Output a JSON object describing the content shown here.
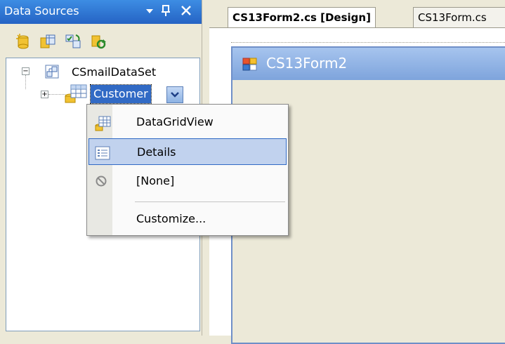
{
  "data_sources_panel": {
    "title": "Data Sources",
    "title_buttons": [
      "dropdown-arrow-icon",
      "pin-icon",
      "close-icon"
    ],
    "toolbar_icons": [
      "add-new-data-source-icon",
      "edit-dataset-with-designer-icon",
      "configure-dataset-icon",
      "refresh-icon"
    ],
    "tree": {
      "dataset": {
        "label": "CSmailDataSet",
        "expanded": true
      },
      "table": {
        "label": "Customer",
        "selected": true,
        "expanded": false
      }
    }
  },
  "context_menu": {
    "items": [
      {
        "label": "DataGridView",
        "icon": "datagridview-icon"
      },
      {
        "label": "Details",
        "icon": "details-icon",
        "highlighted": true
      },
      {
        "label": "[None]",
        "icon": "none-icon"
      },
      {
        "label": "Customize...",
        "icon": ""
      }
    ]
  },
  "document_tabs": [
    {
      "label": "CS13Form2.cs [Design]",
      "active": true
    },
    {
      "label": "CS13Form.cs",
      "active": false
    }
  ],
  "form": {
    "title": "CS13Form2"
  },
  "colors": {
    "titlebar": "#2563c4",
    "selection": "#316ac5",
    "menu_highlight": "#c1d2ee",
    "form_title": "#7ea4dc",
    "panel_bg": "#ece9d8"
  }
}
